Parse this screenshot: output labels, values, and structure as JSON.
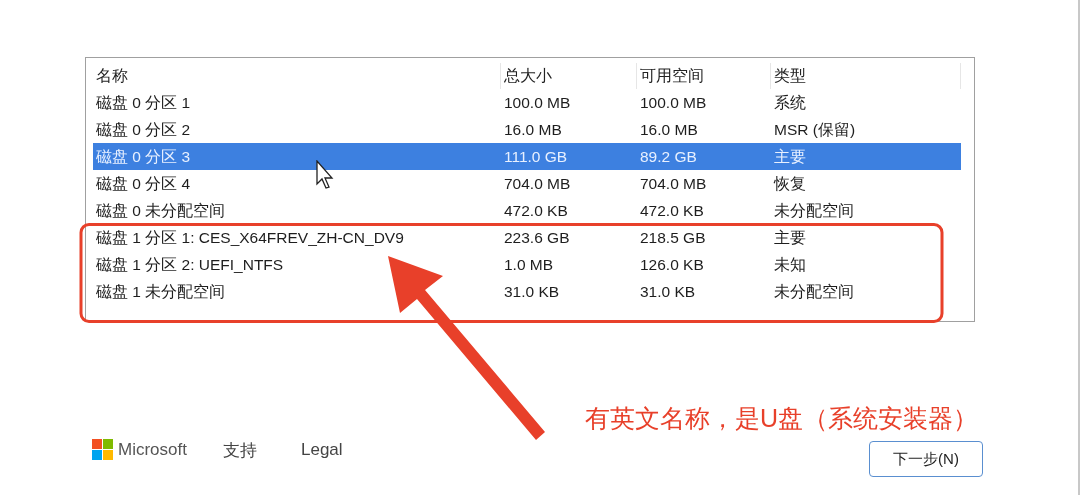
{
  "columns": [
    "名称",
    "总大小",
    "可用空间",
    "类型"
  ],
  "rows": [
    {
      "cells": [
        "磁盘 0 分区 1",
        "100.0 MB",
        "100.0 MB",
        "系统"
      ],
      "selected": false
    },
    {
      "cells": [
        "磁盘 0 分区 2",
        "16.0 MB",
        "16.0 MB",
        "MSR (保留)"
      ],
      "selected": false
    },
    {
      "cells": [
        "磁盘 0 分区 3",
        "111.0 GB",
        "89.2 GB",
        "主要"
      ],
      "selected": true
    },
    {
      "cells": [
        "磁盘 0 分区 4",
        "704.0 MB",
        "704.0 MB",
        "恢复"
      ],
      "selected": false
    },
    {
      "cells": [
        "磁盘 0 未分配空间",
        "472.0 KB",
        "472.0 KB",
        "未分配空间"
      ],
      "selected": false
    },
    {
      "cells": [
        "磁盘 1 分区 1: CES_X64FREV_ZH-CN_DV9",
        "223.6 GB",
        "218.5 GB",
        "主要"
      ],
      "selected": false
    },
    {
      "cells": [
        "磁盘 1 分区 2: UEFI_NTFS",
        "1.0 MB",
        "126.0 KB",
        "未知"
      ],
      "selected": false
    },
    {
      "cells": [
        "磁盘 1 未分配空间",
        "31.0 KB",
        "31.0 KB",
        "未分配空间"
      ],
      "selected": false
    }
  ],
  "footer": {
    "brand": "Microsoft",
    "links": [
      "支持",
      "Legal"
    ]
  },
  "next_button": "下一步(N)",
  "annotation": {
    "text": "有英文名称，是U盘（系统安装器）"
  }
}
